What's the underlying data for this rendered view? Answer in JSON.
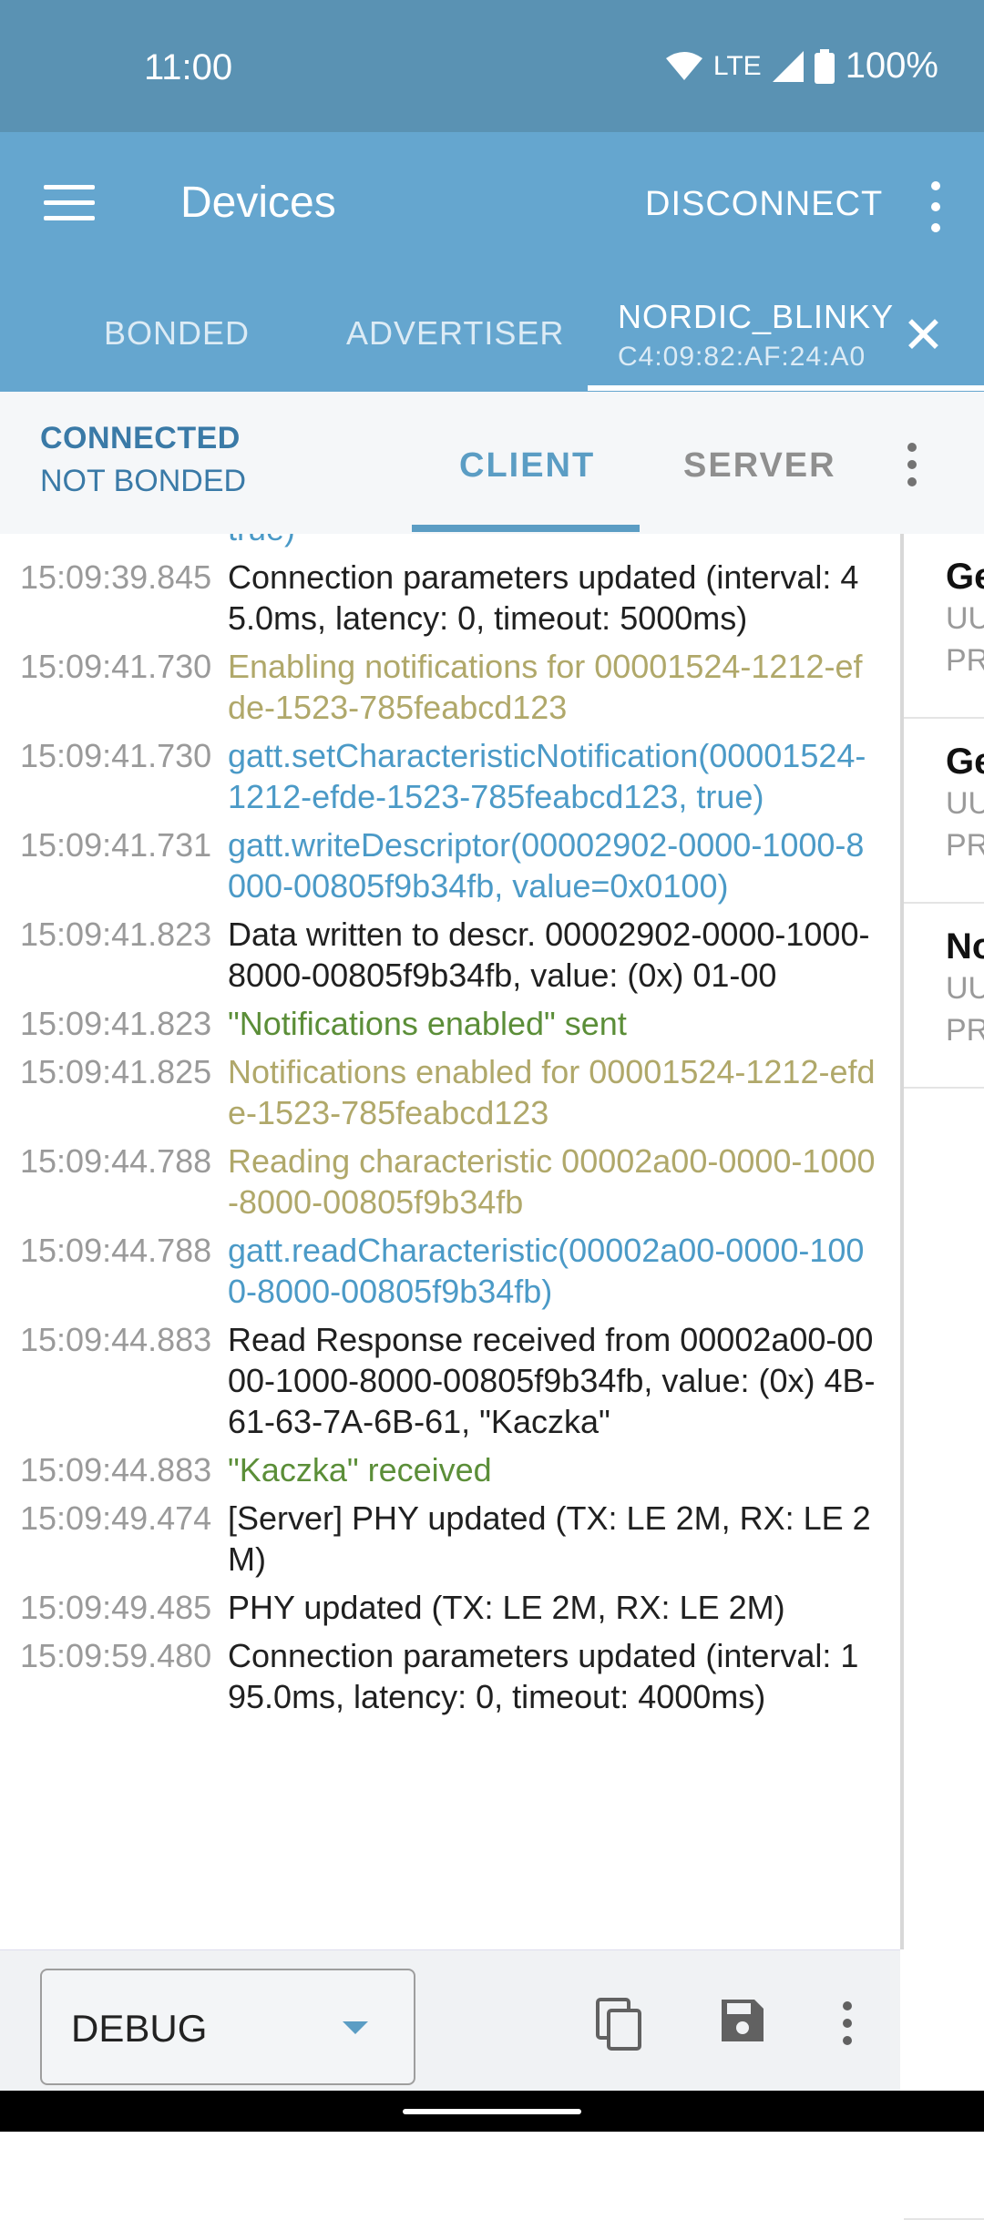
{
  "status_bar": {
    "time": "11:00",
    "network": "LTE",
    "battery": "100%"
  },
  "app_bar": {
    "title": "Devices",
    "disconnect_label": "DISCONNECT"
  },
  "tabs": {
    "bonded": "BONDED",
    "advertiser": "ADVERTISER",
    "device_name": "NORDIC_BLINKY",
    "device_mac": "C4:09:82:AF:24:A0"
  },
  "subbar": {
    "connected": "CONNECTED",
    "bond_state": "NOT BONDED",
    "client_tab": "CLIENT",
    "server_tab": "SERVER"
  },
  "log_partial_top": "true)",
  "log": [
    {
      "time": "15:09:39.845",
      "level": "info",
      "text": "Connection parameters updated (interval: 45.0ms, latency: 0, timeout: 5000ms)"
    },
    {
      "time": "15:09:41.730",
      "level": "verbose",
      "text": "Enabling notifications for 00001524-1212-efde-1523-785feabcd123"
    },
    {
      "time": "15:09:41.730",
      "level": "debug",
      "text": "gatt.setCharacteristicNotification(00001524-1212-efde-1523-785feabcd123, true)"
    },
    {
      "time": "15:09:41.731",
      "level": "debug",
      "text": "gatt.writeDescriptor(00002902-0000-1000-8000-00805f9b34fb, value=0x0100)"
    },
    {
      "time": "15:09:41.823",
      "level": "info",
      "text": "Data written to descr. 00002902-0000-1000-8000-00805f9b34fb, value: (0x) 01-00"
    },
    {
      "time": "15:09:41.823",
      "level": "app",
      "text": "\"Notifications enabled\" sent"
    },
    {
      "time": "15:09:41.825",
      "level": "verbose",
      "text": "Notifications enabled for 00001524-1212-efde-1523-785feabcd123"
    },
    {
      "time": "15:09:44.788",
      "level": "verbose",
      "text": "Reading characteristic 00002a00-0000-1000-8000-00805f9b34fb"
    },
    {
      "time": "15:09:44.788",
      "level": "debug",
      "text": "gatt.readCharacteristic(00002a00-0000-1000-8000-00805f9b34fb)"
    },
    {
      "time": "15:09:44.883",
      "level": "info",
      "text": "Read Response received from 00002a00-0000-1000-8000-00805f9b34fb, value: (0x) 4B-61-63-7A-6B-61, \"Kaczka\""
    },
    {
      "time": "15:09:44.883",
      "level": "app",
      "text": "\"Kaczka\" received"
    },
    {
      "time": "15:09:49.474",
      "level": "info",
      "text": "[Server] PHY updated (TX: LE 2M, RX: LE 2M)"
    },
    {
      "time": "15:09:49.485",
      "level": "info",
      "text": "PHY updated (TX: LE 2M, RX: LE 2M)"
    },
    {
      "time": "15:09:59.480",
      "level": "info",
      "text": "Connection parameters updated (interval: 195.0ms, latency: 0, timeout: 4000ms)"
    }
  ],
  "services": [
    {
      "title": "Ge",
      "line1": "UU",
      "line2": "PR"
    },
    {
      "title": "Ge",
      "line1": "UU",
      "line2": "PR"
    },
    {
      "title": "No",
      "line1": "UU",
      "line2": "PR"
    }
  ],
  "bottom_bar": {
    "log_level": "DEBUG"
  },
  "colors": {
    "status_bar": "#5a92b3",
    "app_bar": "#65a6cf",
    "accent": "#5b9dc4",
    "log_info": "#202020",
    "log_verbose": "#b0a86a",
    "log_debug": "#4b9ac7",
    "log_app": "#5b8e38"
  },
  "icons": {
    "menu": "hamburger-menu-icon",
    "overflow": "more-vert-icon",
    "close": "close-icon",
    "copy": "copy-icon",
    "save": "save-icon",
    "dropdown": "arrow-drop-down-icon"
  }
}
